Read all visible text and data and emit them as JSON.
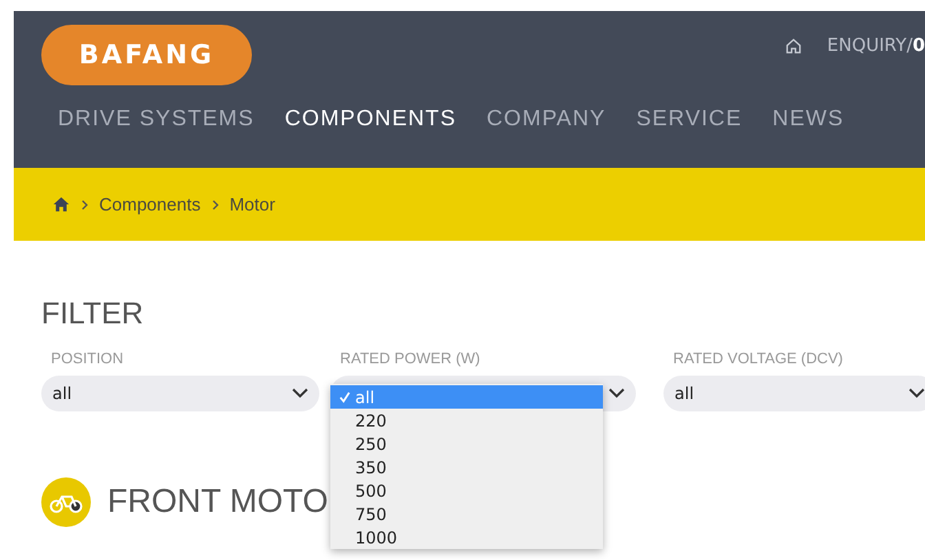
{
  "header": {
    "logo": "BAFANG",
    "enquiry": {
      "label": "ENQUIRY/",
      "count": "0"
    },
    "nav": [
      {
        "label": "DRIVE SYSTEMS",
        "selected": false
      },
      {
        "label": "COMPONENTS",
        "selected": true
      },
      {
        "label": "COMPANY",
        "selected": false
      },
      {
        "label": "SERVICE",
        "selected": false
      },
      {
        "label": "NEWS",
        "selected": false
      }
    ]
  },
  "breadcrumb": [
    "Components",
    "Motor"
  ],
  "filter": {
    "title": "FILTER",
    "fields": [
      {
        "label": "POSITION",
        "value": "all"
      },
      {
        "label": "RATED POWER (W)",
        "options": [
          {
            "label": "all",
            "selected": true
          },
          {
            "label": "220",
            "selected": false
          },
          {
            "label": "250",
            "selected": false
          },
          {
            "label": "350",
            "selected": false
          },
          {
            "label": "500",
            "selected": false
          },
          {
            "label": "750",
            "selected": false
          },
          {
            "label": "1000",
            "selected": false
          }
        ]
      },
      {
        "label": "RATED VOLTAGE (DCV)",
        "value": "all"
      }
    ]
  },
  "section": {
    "title": "FRONT MOTO"
  }
}
